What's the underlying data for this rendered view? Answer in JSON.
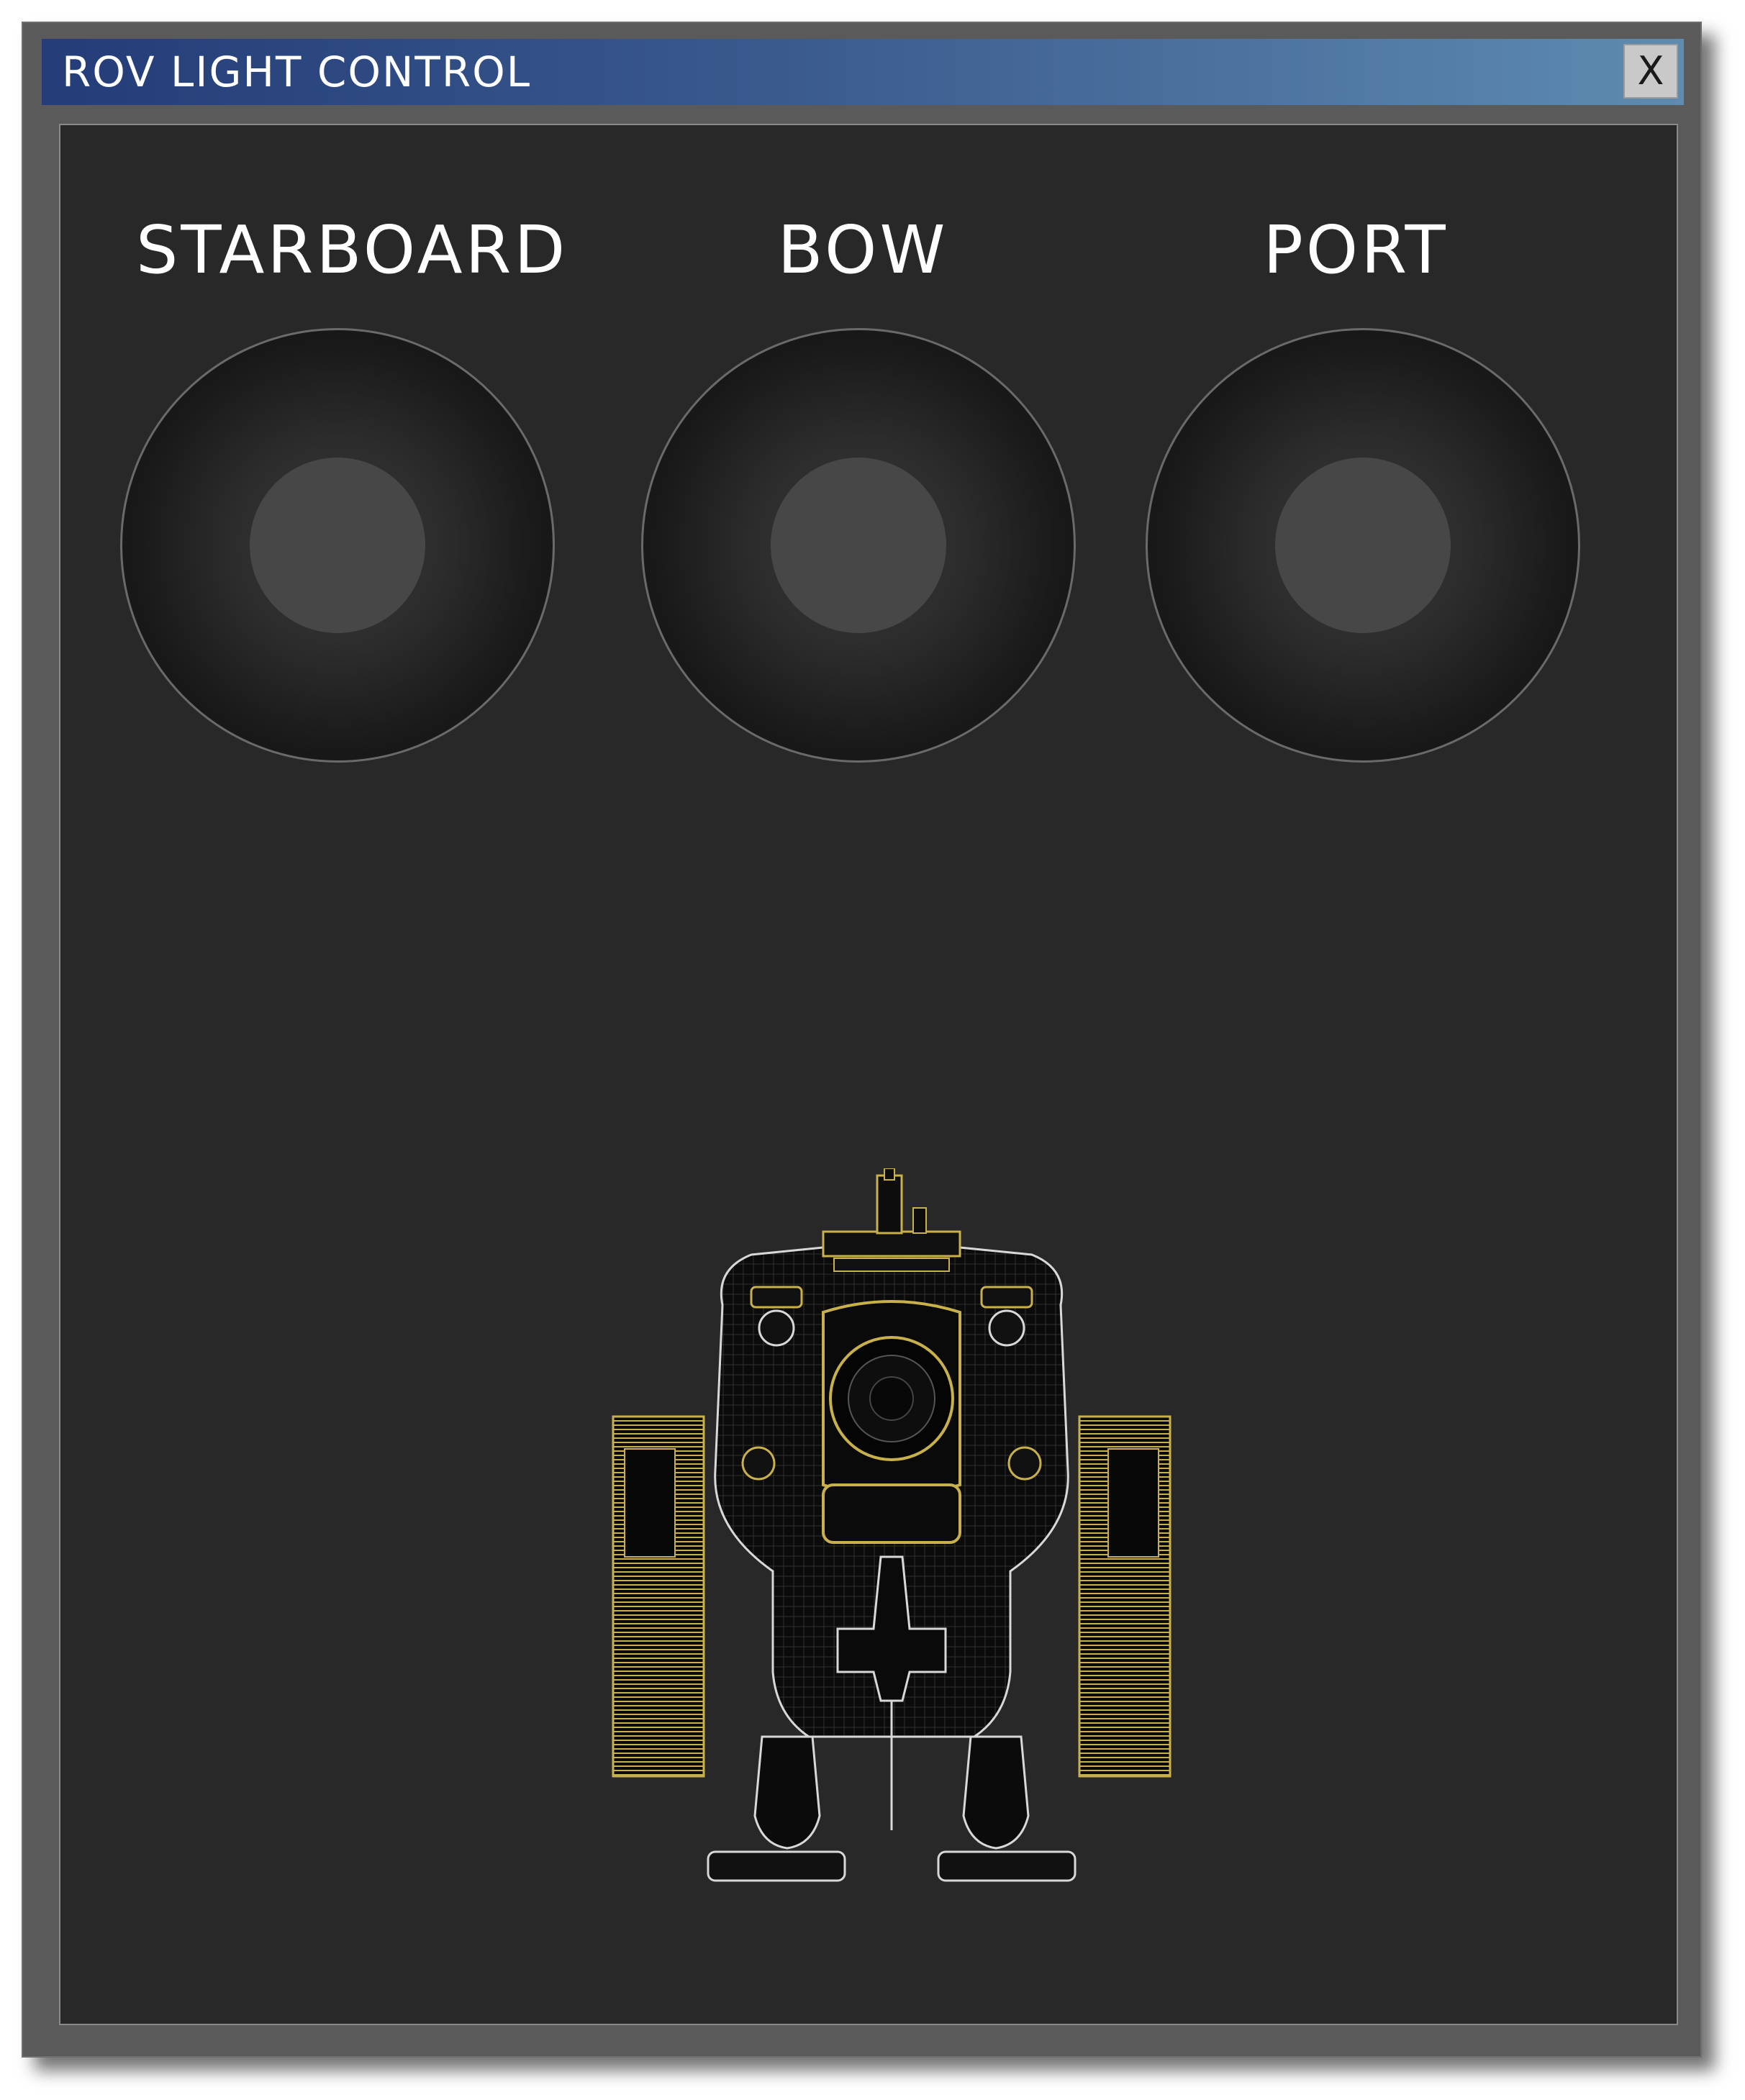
{
  "window": {
    "title": "ROV LIGHT CONTROL",
    "close_label": "X"
  },
  "lights": [
    {
      "label": "STARBOARD"
    },
    {
      "label": "BOW"
    },
    {
      "label": "PORT"
    }
  ],
  "colors": {
    "titlebar_start": "#243c78",
    "titlebar_end": "#5e8bb0",
    "panel_bg": "#282828",
    "rov_outline": "#c8b04a"
  },
  "icons": {
    "close": "close-icon",
    "rov": "rov-wireframe-icon"
  }
}
